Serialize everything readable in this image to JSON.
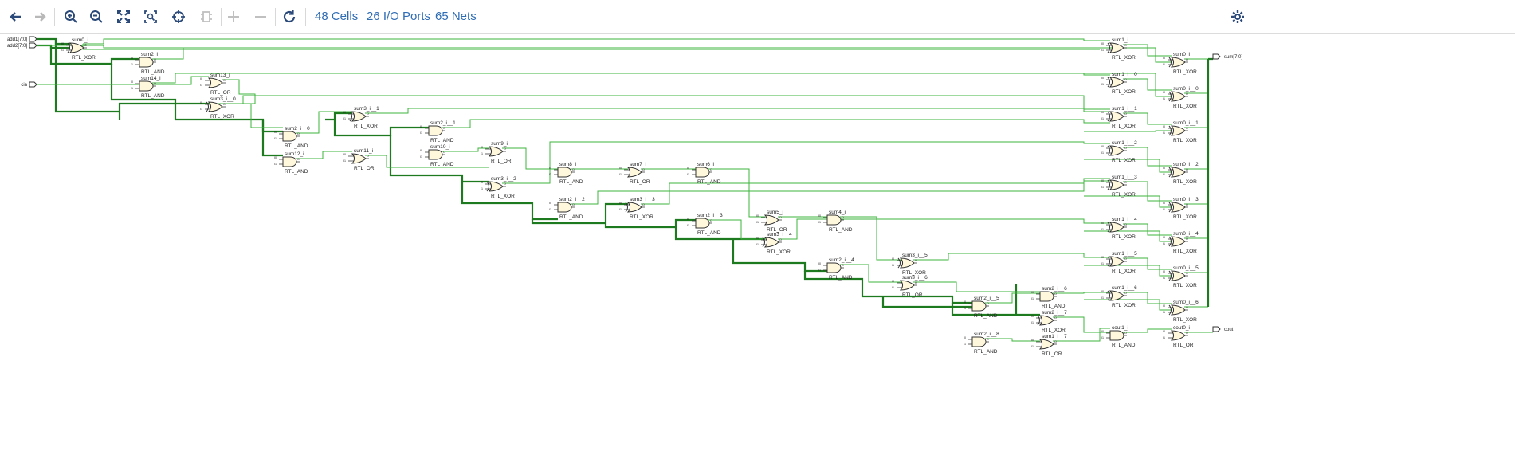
{
  "toolbar": {
    "buttons": [
      {
        "name": "back-button",
        "icon": "arrow-left-icon",
        "enabled": true
      },
      {
        "name": "forward-button",
        "icon": "arrow-right-icon",
        "enabled": false
      },
      {
        "name": "zoom-in-button",
        "icon": "zoom-in-icon",
        "enabled": true
      },
      {
        "name": "zoom-out-button",
        "icon": "zoom-out-icon",
        "enabled": true
      },
      {
        "name": "zoom-fit-button",
        "icon": "fit-icon",
        "enabled": true
      },
      {
        "name": "zoom-area-button",
        "icon": "zoom-area-icon",
        "enabled": true
      },
      {
        "name": "select-area-button",
        "icon": "crosshair-icon",
        "enabled": true
      },
      {
        "name": "regenerate-button",
        "icon": "chip-icon",
        "enabled": false
      },
      {
        "name": "expand-button",
        "icon": "plus-icon",
        "enabled": false
      },
      {
        "name": "collapse-button",
        "icon": "minus-icon",
        "enabled": false
      },
      {
        "name": "refresh-button",
        "icon": "refresh-icon",
        "enabled": true
      }
    ],
    "cells_link": "48 Cells",
    "ports_link": "26 I/O Ports",
    "nets_link": "65 Nets",
    "settings_icon": "gear-icon"
  },
  "colors": {
    "accent": "#2f6db5",
    "net": "#3cb43c",
    "bus": "#1e7a1e",
    "gate_fill": "#fff8dc",
    "gate_stroke": "#333333"
  },
  "ports": {
    "inputs": [
      "add1[7:0]",
      "add2[7:0]",
      "cin"
    ],
    "outputs": [
      "sum[7:0]",
      "cout"
    ]
  },
  "pin_labels": [
    "I0",
    "I1",
    "O"
  ],
  "cells": [
    {
      "name": "sum0_i",
      "type": "RTL_XOR",
      "kind": "xor"
    },
    {
      "name": "sum2_i",
      "type": "RTL_AND",
      "kind": "and"
    },
    {
      "name": "sum14_i",
      "type": "RTL_AND",
      "kind": "and"
    },
    {
      "name": "sum13_i",
      "type": "RTL_OR",
      "kind": "or"
    },
    {
      "name": "sum3_i__0",
      "type": "RTL_XOR",
      "kind": "xor"
    },
    {
      "name": "sum2_i__0",
      "type": "RTL_AND",
      "kind": "and"
    },
    {
      "name": "sum12_i",
      "type": "RTL_AND",
      "kind": "and"
    },
    {
      "name": "sum3_i__1",
      "type": "RTL_XOR",
      "kind": "xor"
    },
    {
      "name": "sum11_i",
      "type": "RTL_OR",
      "kind": "or"
    },
    {
      "name": "sum2_i__1",
      "type": "RTL_AND",
      "kind": "and"
    },
    {
      "name": "sum10_i",
      "type": "RTL_AND",
      "kind": "and"
    },
    {
      "name": "sum9_i",
      "type": "RTL_OR",
      "kind": "or"
    },
    {
      "name": "sum3_i__2",
      "type": "RTL_XOR",
      "kind": "xor"
    },
    {
      "name": "sum8_i",
      "type": "RTL_AND",
      "kind": "and"
    },
    {
      "name": "sum2_i__2",
      "type": "RTL_AND",
      "kind": "and"
    },
    {
      "name": "sum7_i",
      "type": "RTL_OR",
      "kind": "or"
    },
    {
      "name": "sum3_i__3",
      "type": "RTL_XOR",
      "kind": "xor"
    },
    {
      "name": "sum6_i",
      "type": "RTL_AND",
      "kind": "and"
    },
    {
      "name": "sum2_i__3",
      "type": "RTL_AND",
      "kind": "and"
    },
    {
      "name": "sum5_i",
      "type": "RTL_OR",
      "kind": "or"
    },
    {
      "name": "sum3_i__4",
      "type": "RTL_XOR",
      "kind": "xor"
    },
    {
      "name": "sum4_i",
      "type": "RTL_AND",
      "kind": "and"
    },
    {
      "name": "sum2_i__4",
      "type": "RTL_AND",
      "kind": "and"
    },
    {
      "name": "sum3_i__5",
      "type": "RTL_XOR",
      "kind": "xor"
    },
    {
      "name": "sum3_i__6",
      "type": "RTL_OR",
      "kind": "or"
    },
    {
      "name": "sum2_i__5",
      "type": "RTL_AND",
      "kind": "and"
    },
    {
      "name": "sum2_i__8",
      "type": "RTL_AND",
      "kind": "and"
    },
    {
      "name": "sum2_i__6",
      "type": "RTL_AND",
      "kind": "and"
    },
    {
      "name": "sum2_i__7",
      "type": "RTL_XOR",
      "kind": "xor"
    },
    {
      "name": "sum1_i__7",
      "type": "RTL_OR",
      "kind": "or"
    },
    {
      "name": "sum1_i",
      "type": "RTL_XOR",
      "kind": "xor"
    },
    {
      "name": "sum1_i__0",
      "type": "RTL_XOR",
      "kind": "xor"
    },
    {
      "name": "sum1_i__1",
      "type": "RTL_XOR",
      "kind": "xor"
    },
    {
      "name": "sum1_i__2",
      "type": "RTL_XOR",
      "kind": "xor"
    },
    {
      "name": "sum1_i__3",
      "type": "RTL_XOR",
      "kind": "xor"
    },
    {
      "name": "sum1_i__4",
      "type": "RTL_XOR",
      "kind": "xor"
    },
    {
      "name": "sum1_i__5",
      "type": "RTL_XOR",
      "kind": "xor"
    },
    {
      "name": "sum1_i__6",
      "type": "RTL_XOR",
      "kind": "xor"
    },
    {
      "name": "cout1_i",
      "type": "RTL_AND",
      "kind": "and"
    },
    {
      "name": "sum0_i",
      "type": "RTL_XOR",
      "kind": "xor"
    },
    {
      "name": "sum0_i__0",
      "type": "RTL_XOR",
      "kind": "xor"
    },
    {
      "name": "sum0_i__1",
      "type": "RTL_XOR",
      "kind": "xor"
    },
    {
      "name": "sum0_i__2",
      "type": "RTL_XOR",
      "kind": "xor"
    },
    {
      "name": "sum0_i__3",
      "type": "RTL_XOR",
      "kind": "xor"
    },
    {
      "name": "sum0_i__4",
      "type": "RTL_XOR",
      "kind": "xor"
    },
    {
      "name": "sum0_i__5",
      "type": "RTL_XOR",
      "kind": "xor"
    },
    {
      "name": "sum0_i__6",
      "type": "RTL_XOR",
      "kind": "xor"
    },
    {
      "name": "cout0_i",
      "type": "RTL_OR",
      "kind": "or"
    }
  ]
}
